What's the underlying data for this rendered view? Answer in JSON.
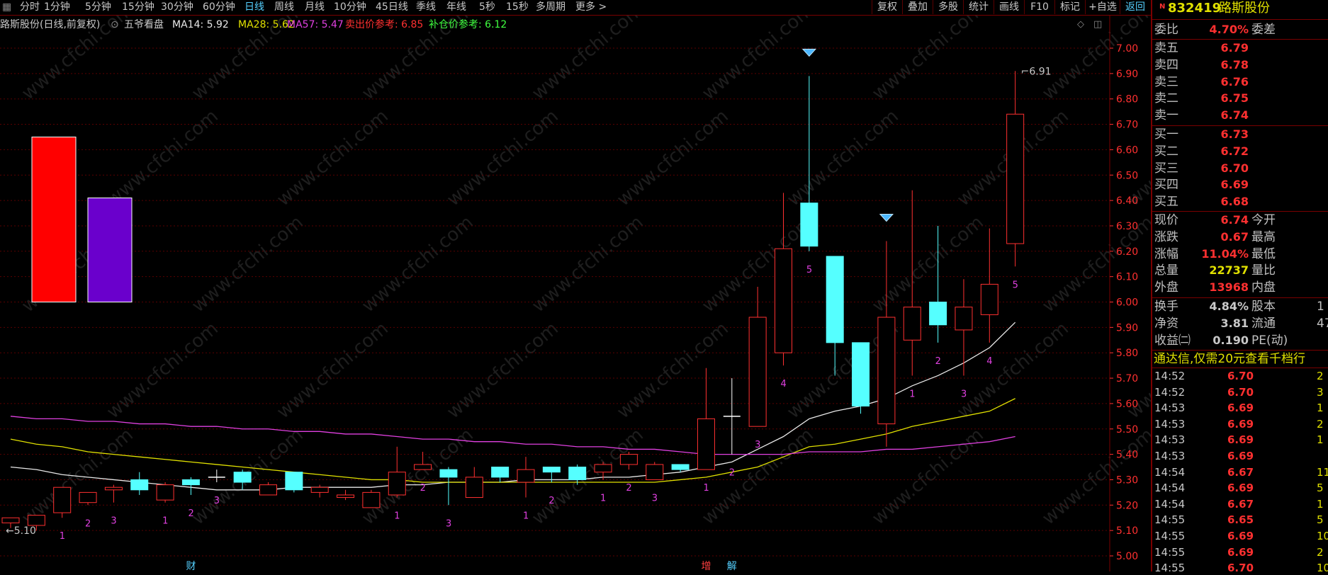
{
  "toolbar": {
    "icon": "grid-icon",
    "periods": [
      "分时",
      "1分钟",
      "5分钟",
      "15分钟",
      "30分钟",
      "60分钟",
      "日线",
      "周线",
      "月线",
      "10分钟",
      "45日线",
      "季线",
      "年线",
      "5秒",
      "15秒",
      "多周期",
      "更多 >"
    ],
    "active": "日线",
    "buttons": [
      "复权",
      "叠加",
      "多股",
      "统计",
      "画线",
      "F10",
      "标记",
      "+自选",
      "返回"
    ],
    "back_color": "#55d0ff"
  },
  "legend": {
    "stock": "路斯股份(日线,前复权)",
    "indicator": "五爷看盘",
    "ma14": "MA14: 5.92",
    "ma28": "MA28: 5.62",
    "ma57": "MA57: 5.47",
    "sell_ref": "卖出价参考: 6.85",
    "buy_ref": "补仓价参考: 6.12"
  },
  "chart_data": {
    "type": "candlestick",
    "title": "路斯股份(日线,前复权)",
    "ylim": [
      5.0,
      7.0
    ],
    "y_ticks": [
      "7.00",
      "6.90",
      "6.80",
      "6.70",
      "6.60",
      "6.50",
      "6.40",
      "6.30",
      "6.20",
      "6.10",
      "6.00",
      "5.90",
      "5.80",
      "5.70",
      "5.60",
      "5.50",
      "5.40",
      "5.30",
      "5.20",
      "5.10",
      "5.00"
    ],
    "candles": [
      {
        "open": 5.13,
        "high": 5.15,
        "low": 5.11,
        "close": 5.15
      },
      {
        "open": 5.12,
        "high": 5.16,
        "low": 5.1,
        "close": 5.16
      },
      {
        "open": 5.17,
        "high": 5.27,
        "low": 5.15,
        "close": 5.27
      },
      {
        "open": 5.21,
        "high": 5.25,
        "low": 5.2,
        "close": 5.25
      },
      {
        "open": 5.26,
        "high": 5.28,
        "low": 5.21,
        "close": 5.27
      },
      {
        "open": 5.3,
        "high": 5.33,
        "low": 5.24,
        "close": 5.26
      },
      {
        "open": 5.22,
        "high": 5.29,
        "low": 5.21,
        "close": 5.28
      },
      {
        "open": 5.3,
        "high": 5.31,
        "low": 5.24,
        "close": 5.28
      },
      {
        "open": 5.31,
        "high": 5.34,
        "low": 5.29,
        "close": 5.31
      },
      {
        "open": 5.33,
        "high": 5.34,
        "low": 5.26,
        "close": 5.29
      },
      {
        "open": 5.24,
        "high": 5.29,
        "low": 5.24,
        "close": 5.28
      },
      {
        "open": 5.33,
        "high": 5.33,
        "low": 5.25,
        "close": 5.26
      },
      {
        "open": 5.25,
        "high": 5.28,
        "low": 5.23,
        "close": 5.27
      },
      {
        "open": 5.23,
        "high": 5.26,
        "low": 5.22,
        "close": 5.24
      },
      {
        "open": 5.19,
        "high": 5.26,
        "low": 5.19,
        "close": 5.25
      },
      {
        "open": 5.24,
        "high": 5.43,
        "low": 5.23,
        "close": 5.33
      },
      {
        "open": 5.34,
        "high": 5.41,
        "low": 5.34,
        "close": 5.36
      },
      {
        "open": 5.34,
        "high": 5.35,
        "low": 5.2,
        "close": 5.31
      },
      {
        "open": 5.23,
        "high": 5.35,
        "low": 5.23,
        "close": 5.31
      },
      {
        "open": 5.35,
        "high": 5.35,
        "low": 5.29,
        "close": 5.31
      },
      {
        "open": 5.29,
        "high": 5.39,
        "low": 5.23,
        "close": 5.34
      },
      {
        "open": 5.35,
        "high": 5.35,
        "low": 5.29,
        "close": 5.33
      },
      {
        "open": 5.35,
        "high": 5.36,
        "low": 5.28,
        "close": 5.3
      },
      {
        "open": 5.33,
        "high": 5.37,
        "low": 5.3,
        "close": 5.36
      },
      {
        "open": 5.36,
        "high": 5.41,
        "low": 5.34,
        "close": 5.4
      },
      {
        "open": 5.3,
        "high": 5.37,
        "low": 5.3,
        "close": 5.36
      },
      {
        "open": 5.36,
        "high": 5.36,
        "low": 5.33,
        "close": 5.34
      },
      {
        "open": 5.34,
        "high": 5.74,
        "low": 5.34,
        "close": 5.54
      },
      {
        "open": 5.55,
        "high": 5.7,
        "low": 5.4,
        "close": 5.55
      },
      {
        "open": 5.51,
        "high": 6.06,
        "low": 5.51,
        "close": 5.94
      },
      {
        "open": 5.8,
        "high": 6.43,
        "low": 5.75,
        "close": 6.21
      },
      {
        "open": 6.39,
        "high": 6.89,
        "low": 6.2,
        "close": 6.22
      },
      {
        "open": 6.18,
        "high": 6.18,
        "low": 5.71,
        "close": 5.84
      },
      {
        "open": 5.84,
        "high": 5.84,
        "low": 5.56,
        "close": 5.59
      },
      {
        "open": 5.52,
        "high": 6.24,
        "low": 5.43,
        "close": 5.94
      },
      {
        "open": 5.85,
        "high": 6.44,
        "low": 5.71,
        "close": 5.98
      },
      {
        "open": 6.0,
        "high": 6.3,
        "low": 5.84,
        "close": 5.91
      },
      {
        "open": 5.89,
        "high": 6.09,
        "low": 5.71,
        "close": 5.98
      },
      {
        "open": 5.95,
        "high": 6.29,
        "low": 5.84,
        "close": 6.07
      },
      {
        "open": 6.23,
        "high": 6.91,
        "low": 6.14,
        "close": 6.74
      }
    ],
    "series": [
      {
        "name": "MA14",
        "color": "#e8e8e8",
        "values": [
          5.35,
          5.34,
          5.32,
          5.31,
          5.3,
          5.29,
          5.28,
          5.27,
          5.26,
          5.26,
          5.26,
          5.27,
          5.27,
          5.27,
          5.27,
          5.28,
          5.28,
          5.29,
          5.29,
          5.29,
          5.3,
          5.3,
          5.3,
          5.31,
          5.31,
          5.32,
          5.33,
          5.35,
          5.37,
          5.42,
          5.47,
          5.54,
          5.57,
          5.59,
          5.62,
          5.67,
          5.71,
          5.76,
          5.82,
          5.92
        ]
      },
      {
        "name": "MA28",
        "color": "#e0e000",
        "values": [
          5.46,
          5.44,
          5.43,
          5.41,
          5.4,
          5.39,
          5.38,
          5.37,
          5.36,
          5.35,
          5.34,
          5.33,
          5.32,
          5.31,
          5.3,
          5.3,
          5.29,
          5.29,
          5.29,
          5.29,
          5.29,
          5.29,
          5.29,
          5.29,
          5.29,
          5.29,
          5.3,
          5.31,
          5.33,
          5.35,
          5.39,
          5.43,
          5.44,
          5.46,
          5.48,
          5.51,
          5.53,
          5.55,
          5.57,
          5.62
        ]
      },
      {
        "name": "MA57",
        "color": "#e040e0",
        "values": [
          5.55,
          5.54,
          5.54,
          5.53,
          5.53,
          5.52,
          5.52,
          5.51,
          5.51,
          5.5,
          5.5,
          5.49,
          5.49,
          5.48,
          5.48,
          5.47,
          5.46,
          5.46,
          5.45,
          5.45,
          5.44,
          5.44,
          5.43,
          5.43,
          5.42,
          5.42,
          5.41,
          5.4,
          5.4,
          5.4,
          5.4,
          5.41,
          5.41,
          5.41,
          5.42,
          5.42,
          5.43,
          5.44,
          5.45,
          5.47
        ]
      }
    ],
    "labels": [
      {
        "i": 2,
        "text": "1",
        "pos": "below"
      },
      {
        "i": 3,
        "text": "2",
        "pos": "below"
      },
      {
        "i": 4,
        "text": "3",
        "pos": "below"
      },
      {
        "i": 6,
        "text": "1",
        "pos": "below"
      },
      {
        "i": 7,
        "text": "2",
        "pos": "below"
      },
      {
        "i": 8,
        "text": "3",
        "pos": "below"
      },
      {
        "i": 15,
        "text": "1",
        "pos": "below"
      },
      {
        "i": 16,
        "text": "2",
        "pos": "below"
      },
      {
        "i": 17,
        "text": "3",
        "pos": "below"
      },
      {
        "i": 20,
        "text": "1",
        "pos": "below"
      },
      {
        "i": 21,
        "text": "2",
        "pos": "below"
      },
      {
        "i": 23,
        "text": "1",
        "pos": "below"
      },
      {
        "i": 24,
        "text": "2",
        "pos": "below"
      },
      {
        "i": 25,
        "text": "3",
        "pos": "below"
      },
      {
        "i": 27,
        "text": "1",
        "pos": "below"
      },
      {
        "i": 28,
        "text": "2",
        "pos": "below"
      },
      {
        "i": 29,
        "text": "3",
        "pos": "below"
      },
      {
        "i": 30,
        "text": "4",
        "pos": "below"
      },
      {
        "i": 31,
        "text": "5",
        "pos": "below"
      },
      {
        "i": 35,
        "text": "1",
        "pos": "below"
      },
      {
        "i": 36,
        "text": "2",
        "pos": "below"
      },
      {
        "i": 37,
        "text": "3",
        "pos": "below"
      },
      {
        "i": 38,
        "text": "4",
        "pos": "below"
      },
      {
        "i": 39,
        "text": "5",
        "pos": "below"
      }
    ],
    "diamonds": [
      31,
      34
    ],
    "high_note": "6.91",
    "low_note": "←5.10",
    "bottom_marks": [
      {
        "i": 7,
        "text": "财",
        "color": "#55d0ff"
      },
      {
        "i": 27,
        "text": "增",
        "color": "#ff4040"
      },
      {
        "i": 28,
        "text": "解",
        "color": "#55d0ff"
      }
    ],
    "bars": [
      {
        "color": "#ff0000",
        "value": 6.65
      },
      {
        "color": "#6a00cc",
        "value": 6.41
      }
    ],
    "bar_base": 6.0,
    "watermark": "www.cfchi.com",
    "colors": {
      "up": "#ff3030",
      "down": "#55ffff",
      "grid": "#5a0000",
      "label": "#e040e0"
    }
  },
  "quote": {
    "badge": "N",
    "code": "832419",
    "name": "路斯股份",
    "weibi_label": "委比",
    "weibi_value": "4.70%",
    "weicha_label": "委差",
    "asks": [
      {
        "label": "卖五",
        "price": "6.79"
      },
      {
        "label": "卖四",
        "price": "6.78"
      },
      {
        "label": "卖三",
        "price": "6.76"
      },
      {
        "label": "卖二",
        "price": "6.75"
      },
      {
        "label": "卖一",
        "price": "6.74"
      }
    ],
    "bids": [
      {
        "label": "买一",
        "price": "6.73"
      },
      {
        "label": "买二",
        "price": "6.72"
      },
      {
        "label": "买三",
        "price": "6.70"
      },
      {
        "label": "买四",
        "price": "6.69"
      },
      {
        "label": "买五",
        "price": "6.68"
      }
    ],
    "stats": [
      {
        "label": "现价",
        "value": "6.74",
        "label2": "今开",
        "color": "#ff3030"
      },
      {
        "label": "涨跌",
        "value": "0.67",
        "label2": "最高",
        "color": "#ff3030"
      },
      {
        "label": "涨幅",
        "value": "11.04%",
        "label2": "最低",
        "color": "#ff3030"
      },
      {
        "label": "总量",
        "value": "22737",
        "label2": "量比",
        "color": "#e0e000"
      },
      {
        "label": "外盘",
        "value": "13968",
        "label2": "内盘",
        "color": "#ff3030"
      }
    ],
    "fund": [
      {
        "label": "换手",
        "value": "4.84%",
        "label2": "股本",
        "tail": "1"
      },
      {
        "label": "净资",
        "value": "3.81",
        "label2": "流通",
        "tail": "47"
      },
      {
        "label": "收益㈡",
        "value": "0.190",
        "label2": "PE(动)",
        "tail": ""
      }
    ],
    "promo": "通达信,仅需20元查看千档行",
    "ticks": [
      {
        "time": "14:52",
        "price": "6.70",
        "color": "#ff3030",
        "vol": "2"
      },
      {
        "time": "14:52",
        "price": "6.70",
        "color": "#ff3030",
        "vol": "3"
      },
      {
        "time": "14:53",
        "price": "6.69",
        "color": "#ff3030",
        "vol": "1"
      },
      {
        "time": "14:53",
        "price": "6.69",
        "color": "#ff3030",
        "vol": "2"
      },
      {
        "time": "14:53",
        "price": "6.69",
        "color": "#ff3030",
        "vol": "1"
      },
      {
        "time": "14:53",
        "price": "6.69",
        "color": "#ff3030",
        "vol": ""
      },
      {
        "time": "14:54",
        "price": "6.67",
        "color": "#ff3030",
        "vol": "11"
      },
      {
        "time": "14:54",
        "price": "6.69",
        "color": "#ff3030",
        "vol": "5"
      },
      {
        "time": "14:54",
        "price": "6.67",
        "color": "#ff3030",
        "vol": "1"
      },
      {
        "time": "14:55",
        "price": "6.65",
        "color": "#ff3030",
        "vol": "5"
      },
      {
        "time": "14:55",
        "price": "6.69",
        "color": "#ff3030",
        "vol": "10"
      },
      {
        "time": "14:55",
        "price": "6.69",
        "color": "#ff3030",
        "vol": "2"
      },
      {
        "time": "14:55",
        "price": "6.70",
        "color": "#ff3030",
        "vol": "10"
      }
    ]
  }
}
